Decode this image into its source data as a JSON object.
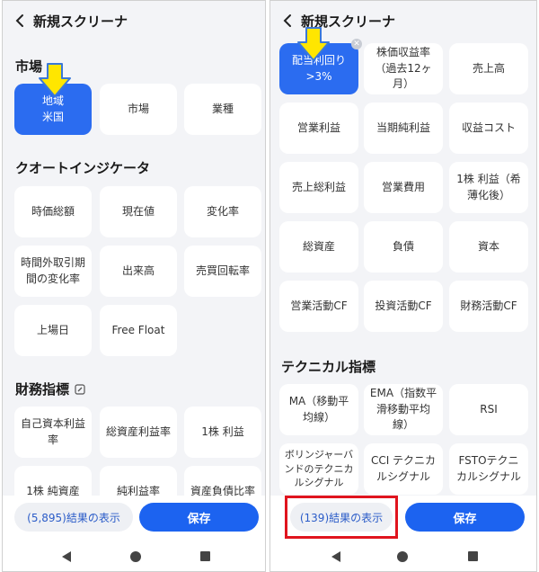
{
  "left": {
    "header": {
      "title": "新規スクリーナ"
    },
    "market": {
      "title": "市場",
      "tiles": [
        {
          "line1": "地域",
          "line2": "米国"
        },
        {
          "line1": "市場"
        },
        {
          "line1": "業種"
        }
      ]
    },
    "quote": {
      "title": "クオートインジケータ",
      "tiles": [
        {
          "line1": "時価総額"
        },
        {
          "line1": "現在値"
        },
        {
          "line1": "変化率"
        },
        {
          "line1": "時間外取引期",
          "line2": "間の変化率"
        },
        {
          "line1": "出来高"
        },
        {
          "line1": "売買回転率"
        },
        {
          "line1": "上場日"
        },
        {
          "line1": "Free Float"
        }
      ]
    },
    "finance": {
      "title": "財務指標",
      "tiles": [
        {
          "line1": "自己資本利益",
          "line2": "率"
        },
        {
          "line1": "総資産利益率"
        },
        {
          "line1": "1株 利益"
        },
        {
          "line1": "1株 純資産"
        },
        {
          "line1": "純利益率"
        },
        {
          "line1": "資産負債比率"
        }
      ]
    },
    "footer": {
      "results": "(5,895)結果の表示",
      "save": "保存"
    }
  },
  "right": {
    "header": {
      "title": "新規スクリーナ"
    },
    "finance_tiles": [
      {
        "line1": "配当利回り",
        "line2": ">3%"
      },
      {
        "line1": "株価収益率",
        "line2": "（過去12ヶ",
        "line3": "月）"
      },
      {
        "line1": "売上高"
      },
      {
        "line1": "営業利益"
      },
      {
        "line1": "当期純利益"
      },
      {
        "line1": "収益コスト"
      },
      {
        "line1": "売上総利益"
      },
      {
        "line1": "営業費用"
      },
      {
        "line1": "1株 利益（希",
        "line2": "薄化後）"
      },
      {
        "line1": "総資産"
      },
      {
        "line1": "負債"
      },
      {
        "line1": "資本"
      },
      {
        "line1": "営業活動CF"
      },
      {
        "line1": "投資活動CF"
      },
      {
        "line1": "財務活動CF"
      }
    ],
    "technical": {
      "title": "テクニカル指標",
      "tiles": [
        {
          "line1": "MA（移動平",
          "line2": "均線）"
        },
        {
          "line1": "EMA（指数平",
          "line2": "滑移動平均",
          "line3": "線）"
        },
        {
          "line1": "RSI"
        },
        {
          "line1": "ボリンジャーバ",
          "line2": "ンドのテクニカ",
          "line3": "ルシグナル"
        },
        {
          "line1": "CCI テクニカ",
          "line2": "ルシグナル"
        },
        {
          "line1": "FSTOテクニ",
          "line2": "カルシグナル"
        }
      ]
    },
    "footer": {
      "results": "(139)結果の表示",
      "save": "保存"
    }
  },
  "colors": {
    "accent": "#1c63f0",
    "selected_tile": "#2b6cf0",
    "background": "#f3f4f7",
    "arrow_fill": "#ffe600",
    "arrow_stroke": "#3a78d8",
    "highlight": "#e0141e"
  },
  "icons": [
    "back-chevron-icon",
    "edit-icon",
    "clear-x-icon",
    "nav-back-icon",
    "nav-home-icon",
    "nav-recents-icon"
  ]
}
